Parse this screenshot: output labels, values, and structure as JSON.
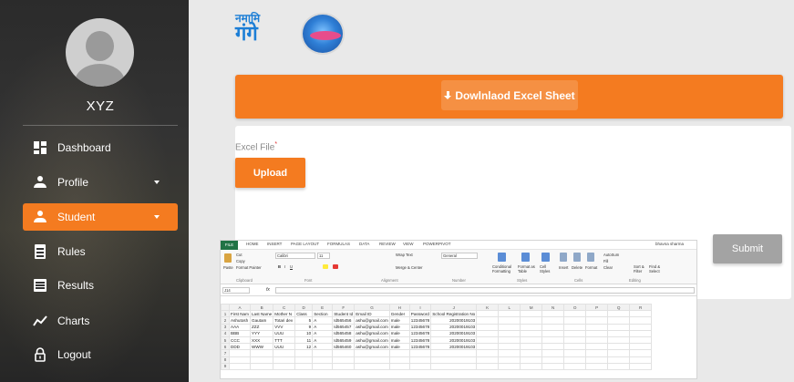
{
  "sidebar": {
    "username": "XYZ",
    "items": [
      {
        "label": "Dashboard",
        "icon": "dashboard-icon",
        "caret": false,
        "active": false
      },
      {
        "label": "Profile",
        "icon": "user-icon",
        "caret": true,
        "active": false
      },
      {
        "label": "Student",
        "icon": "user-icon",
        "caret": true,
        "active": true
      },
      {
        "label": "Rules",
        "icon": "document-icon",
        "caret": false,
        "active": false
      },
      {
        "label": "Results",
        "icon": "list-icon",
        "caret": false,
        "active": false
      },
      {
        "label": "Charts",
        "icon": "line-chart-icon",
        "caret": false,
        "active": false
      },
      {
        "label": "Logout",
        "icon": "lock-icon",
        "caret": false,
        "active": false
      }
    ]
  },
  "header": {
    "logo_text_top": "नमामि",
    "logo_text_main": "गंगे"
  },
  "main": {
    "download_label": "Dowlnlaod Excel Sheet",
    "excel_file_label": "Excel File",
    "required_mark": "*",
    "upload_label": "Upload",
    "submit_label": "Submit"
  },
  "excel": {
    "tabs": [
      "FILE",
      "HOME",
      "INSERT",
      "PAGE LAYOUT",
      "FORMULAS",
      "DATA",
      "REVIEW",
      "VIEW",
      "POWERPIVOT"
    ],
    "user": "bhavna sharma",
    "ribbon": {
      "cut": "Cut",
      "copy": "Copy",
      "format_painter": "Format Painter",
      "paste": "Paste",
      "clipboard": "Clipboard",
      "font_name": "Calibri",
      "font_size": "11",
      "font_group": "Font",
      "wrap_text": "Wrap Text",
      "merge_center": "Merge & Center",
      "alignment": "Alignment",
      "number_format": "General",
      "number": "Number",
      "conditional": "Conditional Formatting",
      "format_table": "Format as Table",
      "cell_styles": "Cell Styles",
      "styles": "Styles",
      "insert": "Insert",
      "delete": "Delete",
      "format": "Format",
      "cells": "Cells",
      "autosum": "AutoSum",
      "fill": "Fill",
      "clear": "Clear",
      "sort_filter": "Sort & Filter",
      "find_select": "Find & Select",
      "editing": "Editing"
    },
    "name_box": "J14",
    "columns": [
      "",
      "A",
      "B",
      "C",
      "D",
      "E",
      "F",
      "G",
      "H",
      "I",
      "J",
      "K",
      "L",
      "M",
      "N",
      "O",
      "P",
      "Q",
      "R"
    ],
    "rows": [
      [
        "1",
        "First Nam",
        "Last Name",
        "Mother N",
        "Class",
        "Section",
        "Student Id",
        "Email ID",
        "Gender",
        "Password",
        "School Registration No",
        "",
        "",
        "",
        "",
        "",
        "",
        "",
        ""
      ],
      [
        "2",
        "Ashutosh",
        "Gautam",
        "Totari dev",
        "5",
        "A",
        "Id565456",
        "ashu@gmail.com",
        "male",
        "12345678",
        "20200019103",
        "",
        "",
        "",
        "",
        "",
        "",
        "",
        ""
      ],
      [
        "3",
        "AAA",
        "ZZZ",
        "VVV",
        "9",
        "A",
        "Id565457",
        "ashu@gmail.com",
        "male",
        "12345678",
        "20200019103",
        "",
        "",
        "",
        "",
        "",
        "",
        "",
        ""
      ],
      [
        "4",
        "BBB",
        "YYY",
        "UUU",
        "10",
        "A",
        "Id565458",
        "ashu@gmail.com",
        "male",
        "12345678",
        "20200019103",
        "",
        "",
        "",
        "",
        "",
        "",
        "",
        ""
      ],
      [
        "5",
        "CCC",
        "XXX",
        "TTT",
        "11",
        "A",
        "Id565459",
        "ashu@gmail.com",
        "male",
        "12345678",
        "20200019103",
        "",
        "",
        "",
        "",
        "",
        "",
        "",
        ""
      ],
      [
        "6",
        "DDD",
        "WWW",
        "UUU",
        "12",
        "A",
        "Id565460",
        "ashu@gmail.com",
        "male",
        "12345678",
        "20200019103",
        "",
        "",
        "",
        "",
        "",
        "",
        "",
        ""
      ],
      [
        "7",
        "",
        "",
        "",
        "",
        "",
        "",
        "",
        "",
        "",
        "",
        "",
        "",
        "",
        "",
        "",
        "",
        "",
        ""
      ],
      [
        "8",
        "",
        "",
        "",
        "",
        "",
        "",
        "",
        "",
        "",
        "",
        "",
        "",
        "",
        "",
        "",
        "",
        "",
        ""
      ],
      [
        "9",
        "",
        "",
        "",
        "",
        "",
        "",
        "",
        "",
        "",
        "",
        "",
        "",
        "",
        "",
        "",
        "",
        "",
        ""
      ]
    ]
  },
  "colors": {
    "accent": "#f47b20",
    "submit_disabled": "#a3a3a3",
    "excel_green": "#217346"
  }
}
